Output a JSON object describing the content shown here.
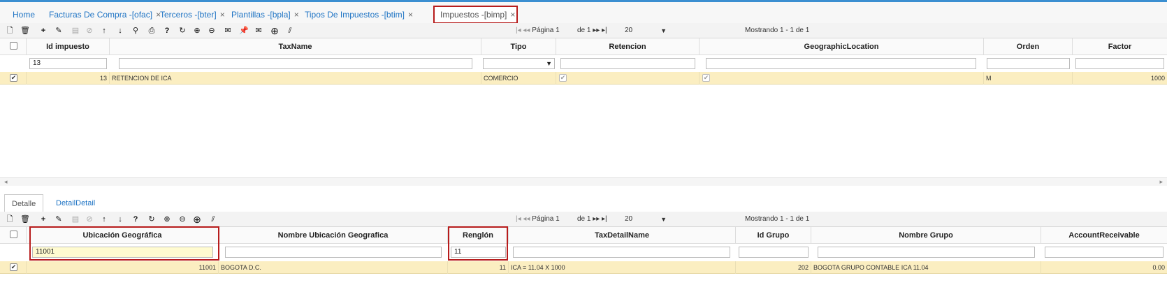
{
  "tabs": [
    {
      "label": "Home",
      "closable": false
    },
    {
      "label": "Facturas De Compra -[ofac]",
      "closable": true
    },
    {
      "label": "Terceros -[bter]",
      "closable": true
    },
    {
      "label": "Plantillas -[bpla]",
      "closable": true
    },
    {
      "label": "Tipos De Impuestos -[btim]",
      "closable": true
    },
    {
      "label": "Impuestos -[bimp]",
      "closable": true,
      "active": true
    }
  ],
  "close_glyph": "×",
  "top_toolbar": {
    "icons": [
      "new-document-icon",
      "delete-icon",
      "add-icon",
      "edit-icon",
      "save-icon",
      "cancel-icon",
      "move-up-icon",
      "move-down-icon",
      "search-icon",
      "print-icon",
      "help-icon",
      "refresh-icon",
      "zoom-in-icon",
      "zoom-out-icon",
      "comment-icon",
      "pin-icon",
      "mail-icon",
      "add-circle-icon",
      "resize-icon"
    ],
    "pager": {
      "first": "|◂",
      "prev": "◂◂",
      "page_label": "Página",
      "page": "1",
      "of_label": "de 1",
      "next": "▸▸",
      "last": "▸|",
      "page_size": "20"
    },
    "showing": "Mostrando 1 - 1 de 1"
  },
  "top_grid": {
    "columns": [
      "Id impuesto",
      "TaxName",
      "Tipo",
      "Retencion",
      "GeographicLocation",
      "Orden",
      "Factor"
    ],
    "filter": {
      "id": "13"
    },
    "rows": [
      {
        "checked": true,
        "id": "13",
        "name": "RETENCION DE ICA",
        "tipo": "COMERCIO",
        "retencion": true,
        "geo": true,
        "orden": "M",
        "factor": "1000"
      }
    ]
  },
  "sub_tabs": [
    {
      "label": "Detalle",
      "active": true
    },
    {
      "label": "DetailDetail",
      "active": false
    }
  ],
  "bottom_toolbar": {
    "icons": [
      "new-document-icon",
      "delete-icon",
      "add-icon",
      "edit-icon",
      "save-icon",
      "cancel-icon",
      "move-up-icon",
      "move-down-icon",
      "help-icon",
      "refresh-icon",
      "zoom-in-icon",
      "zoom-out-icon",
      "add-circle-icon",
      "resize-icon"
    ],
    "pager": {
      "first": "|◂",
      "prev": "◂◂",
      "page_label": "Página",
      "page": "1",
      "of_label": "de 1",
      "next": "▸▸",
      "last": "▸|",
      "page_size": "20"
    },
    "showing": "Mostrando 1 - 1 de 1"
  },
  "bottom_grid": {
    "columns": [
      "Ubicación Geográfica",
      "Nombre Ubicación Geografica",
      "Renglón",
      "TaxDetailName",
      "Id Grupo",
      "Nombre Grupo",
      "AccountReceivable"
    ],
    "filter": {
      "ubicacion": "11001",
      "renglon": "11"
    },
    "rows": [
      {
        "checked": true,
        "ubicacion": "11001",
        "nombre_ubicacion": "BOGOTA D.C.",
        "renglon": "11",
        "detail": "ICA = 11.04 X 1000",
        "id_grupo": "202",
        "nombre_grupo": "BOGOTA GRUPO CONTABLE ICA 11.04",
        "account": "0.00"
      }
    ]
  },
  "glyphs": {
    "check": "✔",
    "dropdown": "▼",
    "scroll_left": "◂",
    "scroll_right": "▸"
  }
}
